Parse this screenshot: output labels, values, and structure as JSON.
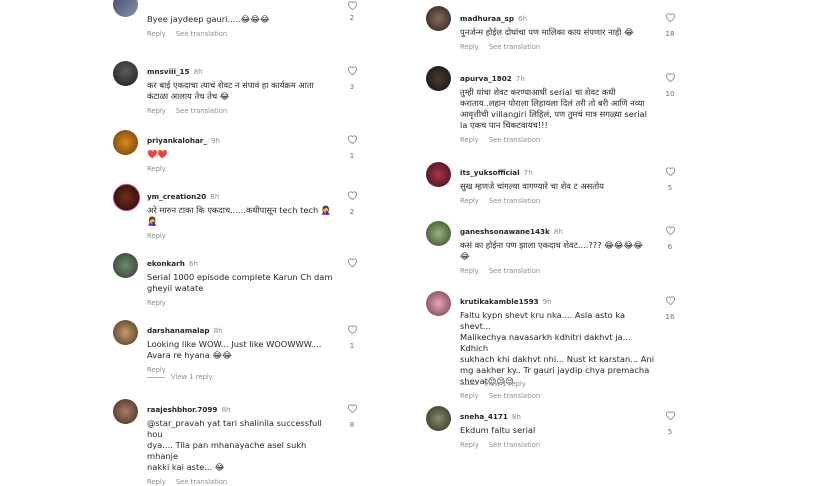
{
  "colors": {
    "text": "#262626",
    "muted": "#8e8e8e",
    "highlight_border": "#c13584"
  },
  "icons": {
    "like": "heart-outline-icon"
  },
  "labels": {
    "reply": "Reply",
    "see_translation": "See translation"
  },
  "left": [
    {
      "username": "",
      "time": "",
      "text": "Byee jaydeep gauri.....😂😂😂",
      "likes": "2",
      "reply": "Reply",
      "translate": "See translation"
    },
    {
      "username": "mnsviii_15",
      "time": "8h",
      "text": "कर बाई एकदाचा त्याचं शेवट न संपावं हा कार्यक्रम आता\nकंटाळा आलाय तेच तेच 😂",
      "likes": "3",
      "reply": "Reply",
      "translate": "See translation"
    },
    {
      "username": "priyankalohar_",
      "time": "9h",
      "text": "❤️❤️",
      "likes": "1",
      "reply": "Reply",
      "translate": ""
    },
    {
      "username": "ym_creation20",
      "time": "8h",
      "text": "अरे मारुन टाका कि एकदाच......कधीपासून tech tech 🤦‍♀️\n🤦‍♀️",
      "likes": "2",
      "reply": "Reply",
      "translate": ""
    },
    {
      "username": "ekonkarh",
      "time": "6h",
      "text": "Serial 1000 episode complete Karun Ch dam\ngheyil watate",
      "likes": "",
      "reply": "Reply",
      "translate": ""
    },
    {
      "username": "darshanamalap",
      "time": "8h",
      "text": "Looking like WOW... Just like WOOWWW....\nAvara re hyana 😂😂",
      "likes": "1",
      "reply": "Reply",
      "translate": ""
    },
    {
      "username": "raajeshbhor.7099",
      "time": "8h",
      "text": "@star_pravah yat tari shalinila successfull hou\ndya.... Tila pan mhanayache asel sukh mhanje\nnakki kai aste... 😂",
      "likes": "8",
      "reply": "Reply",
      "translate": "See translation"
    }
  ],
  "left_view_replies": "View 1 reply",
  "right": [
    {
      "username": "madhuraa_sp",
      "time": "6h",
      "text": "पुनर्जन्म होईल दोघांचा पण मालिका काय संपणार नाही 😂",
      "likes": "18",
      "reply": "Reply",
      "translate": "See translation"
    },
    {
      "username": "apurva_1802",
      "time": "7h",
      "text": "तुम्ही यांचा शेवट करण्याआधी serial चा शेवट कधी\nकराताय..लहान पोराला लिहायला दिलं तरी तो बरी आणि नव्या\nआवृत्तीची villangiri लिहिलं, पण तुमचं मात्र सगळ्या serial\nla एकच पान चिकटवायच!!!",
      "likes": "10",
      "reply": "Reply",
      "translate": "See translation"
    },
    {
      "username": "its_yuksofficial",
      "time": "7h",
      "text": "सुख म्हणजे चांगल्या वागण्यारे चा शेव ट असतोय",
      "likes": "5",
      "reply": "Reply",
      "translate": "See translation"
    },
    {
      "username": "ganeshsonawane143k",
      "time": "8h",
      "text": "कसं का होईना पण झाला एकदाच शेवट....??? 😂😂😂😂\n😂",
      "likes": "6",
      "reply": "Reply",
      "translate": "See translation"
    },
    {
      "username": "krutikakamble1593",
      "time": "9h",
      "text": "Faltu kypn shevt kru nka.... Asla asto ka shevt...\nMalikechya navasarkh kdhitri dakhvt ja... Kdhich\nsukhach khi dakhvt nhi... Nust kt karstan... Ani\nmg aakher ky.. Tr gauri jaydip chya premacha\nshevat😒😒😒",
      "likes": "16",
      "reply": "Reply",
      "translate": "See translation"
    },
    {
      "username": "sneha_4171",
      "time": "8h",
      "text": "Ekdum faltu serial",
      "likes": "5",
      "reply": "Reply",
      "translate": "See translation"
    }
  ],
  "right_view_replies": "View 1 reply"
}
